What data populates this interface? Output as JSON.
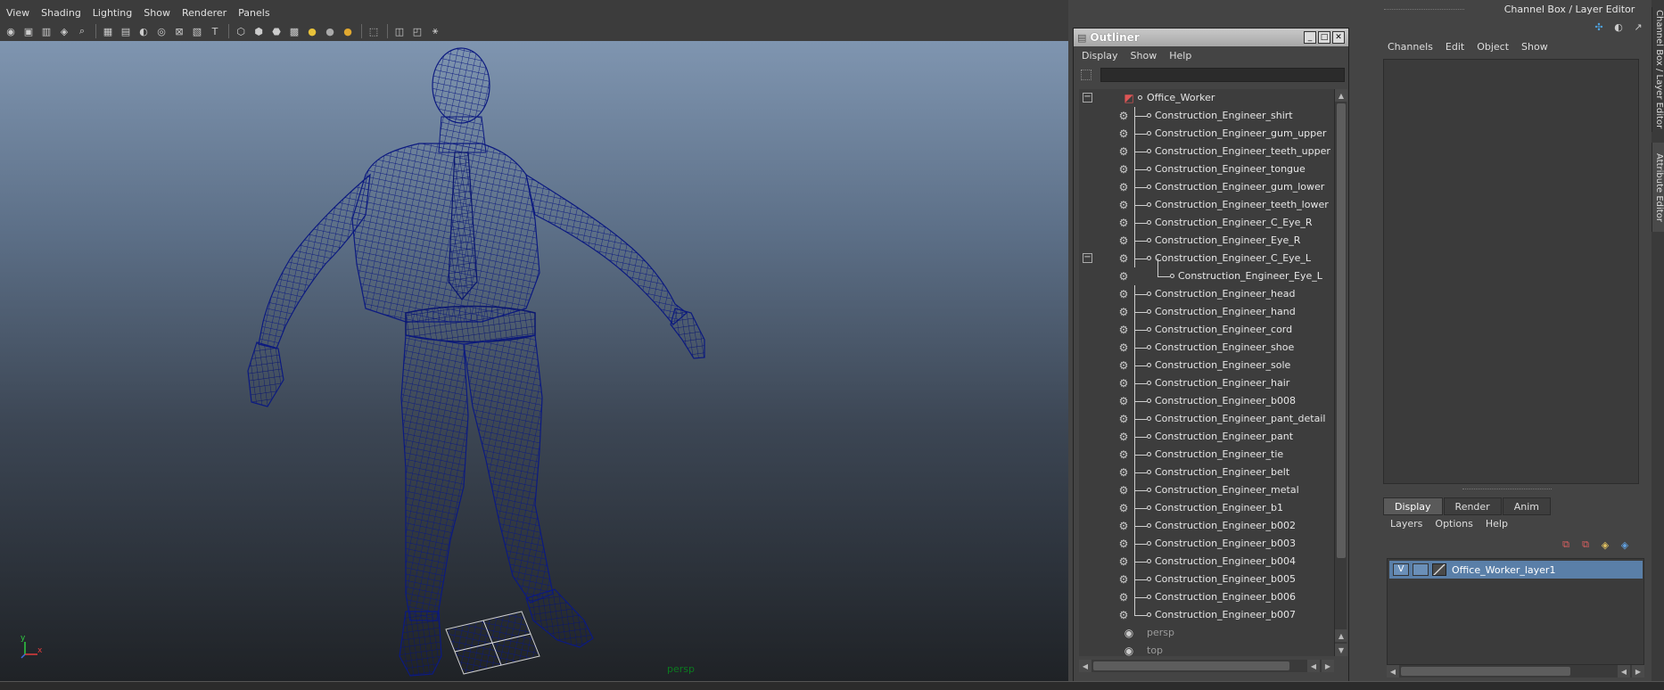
{
  "viewport": {
    "menus": [
      "View",
      "Shading",
      "Lighting",
      "Show",
      "Renderer",
      "Panels"
    ],
    "camera_label": "persp",
    "axis": {
      "y": "y",
      "x": "x"
    },
    "wireframe_color": "#0c1a80"
  },
  "outliner": {
    "title": "Outliner",
    "menus": [
      "Display",
      "Show",
      "Help"
    ],
    "search_value": "",
    "items": [
      {
        "label": "Office_Worker",
        "kind": "root",
        "expanded": true
      },
      {
        "label": "Construction_Engineer_shirt",
        "kind": "mesh"
      },
      {
        "label": "Construction_Engineer_gum_upper",
        "kind": "mesh"
      },
      {
        "label": "Construction_Engineer_teeth_upper",
        "kind": "mesh"
      },
      {
        "label": "Construction_Engineer_tongue",
        "kind": "mesh"
      },
      {
        "label": "Construction_Engineer_gum_lower",
        "kind": "mesh"
      },
      {
        "label": "Construction_Engineer_teeth_lower",
        "kind": "mesh"
      },
      {
        "label": "Construction_Engineer_C_Eye_R",
        "kind": "mesh"
      },
      {
        "label": "Construction_Engineer_Eye_R",
        "kind": "mesh"
      },
      {
        "label": "Construction_Engineer_C_Eye_L",
        "kind": "mesh",
        "expanded": true
      },
      {
        "label": "Construction_Engineer_Eye_L",
        "kind": "child"
      },
      {
        "label": "Construction_Engineer_head",
        "kind": "mesh"
      },
      {
        "label": "Construction_Engineer_hand",
        "kind": "mesh"
      },
      {
        "label": "Construction_Engineer_cord",
        "kind": "mesh"
      },
      {
        "label": "Construction_Engineer_shoe",
        "kind": "mesh"
      },
      {
        "label": "Construction_Engineer_sole",
        "kind": "mesh"
      },
      {
        "label": "Construction_Engineer_hair",
        "kind": "mesh"
      },
      {
        "label": "Construction_Engineer_b008",
        "kind": "mesh"
      },
      {
        "label": "Construction_Engineer_pant_detail",
        "kind": "mesh"
      },
      {
        "label": "Construction_Engineer_pant",
        "kind": "mesh"
      },
      {
        "label": "Construction_Engineer_tie",
        "kind": "mesh"
      },
      {
        "label": "Construction_Engineer_belt",
        "kind": "mesh"
      },
      {
        "label": "Construction_Engineer_metal",
        "kind": "mesh"
      },
      {
        "label": "Construction_Engineer_b1",
        "kind": "mesh"
      },
      {
        "label": "Construction_Engineer_b002",
        "kind": "mesh"
      },
      {
        "label": "Construction_Engineer_b003",
        "kind": "mesh"
      },
      {
        "label": "Construction_Engineer_b004",
        "kind": "mesh"
      },
      {
        "label": "Construction_Engineer_b005",
        "kind": "mesh"
      },
      {
        "label": "Construction_Engineer_b006",
        "kind": "mesh"
      },
      {
        "label": "Construction_Engineer_b007",
        "kind": "mesh",
        "last": true
      },
      {
        "label": "persp",
        "kind": "camera"
      },
      {
        "label": "top",
        "kind": "camera"
      }
    ]
  },
  "channel_box": {
    "title": "Channel Box / Layer Editor",
    "menus": [
      "Channels",
      "Edit",
      "Object",
      "Show"
    ],
    "tabs": [
      "Display",
      "Render",
      "Anim"
    ],
    "active_tab": "Display",
    "layer_menus": [
      "Layers",
      "Options",
      "Help"
    ],
    "layer": {
      "visibility": "V",
      "name": "Office_Worker_layer1"
    },
    "highlight_color": "#5a7fa8"
  },
  "side_tabs": [
    "Channel Box / Layer Editor",
    "Attribute Editor"
  ]
}
